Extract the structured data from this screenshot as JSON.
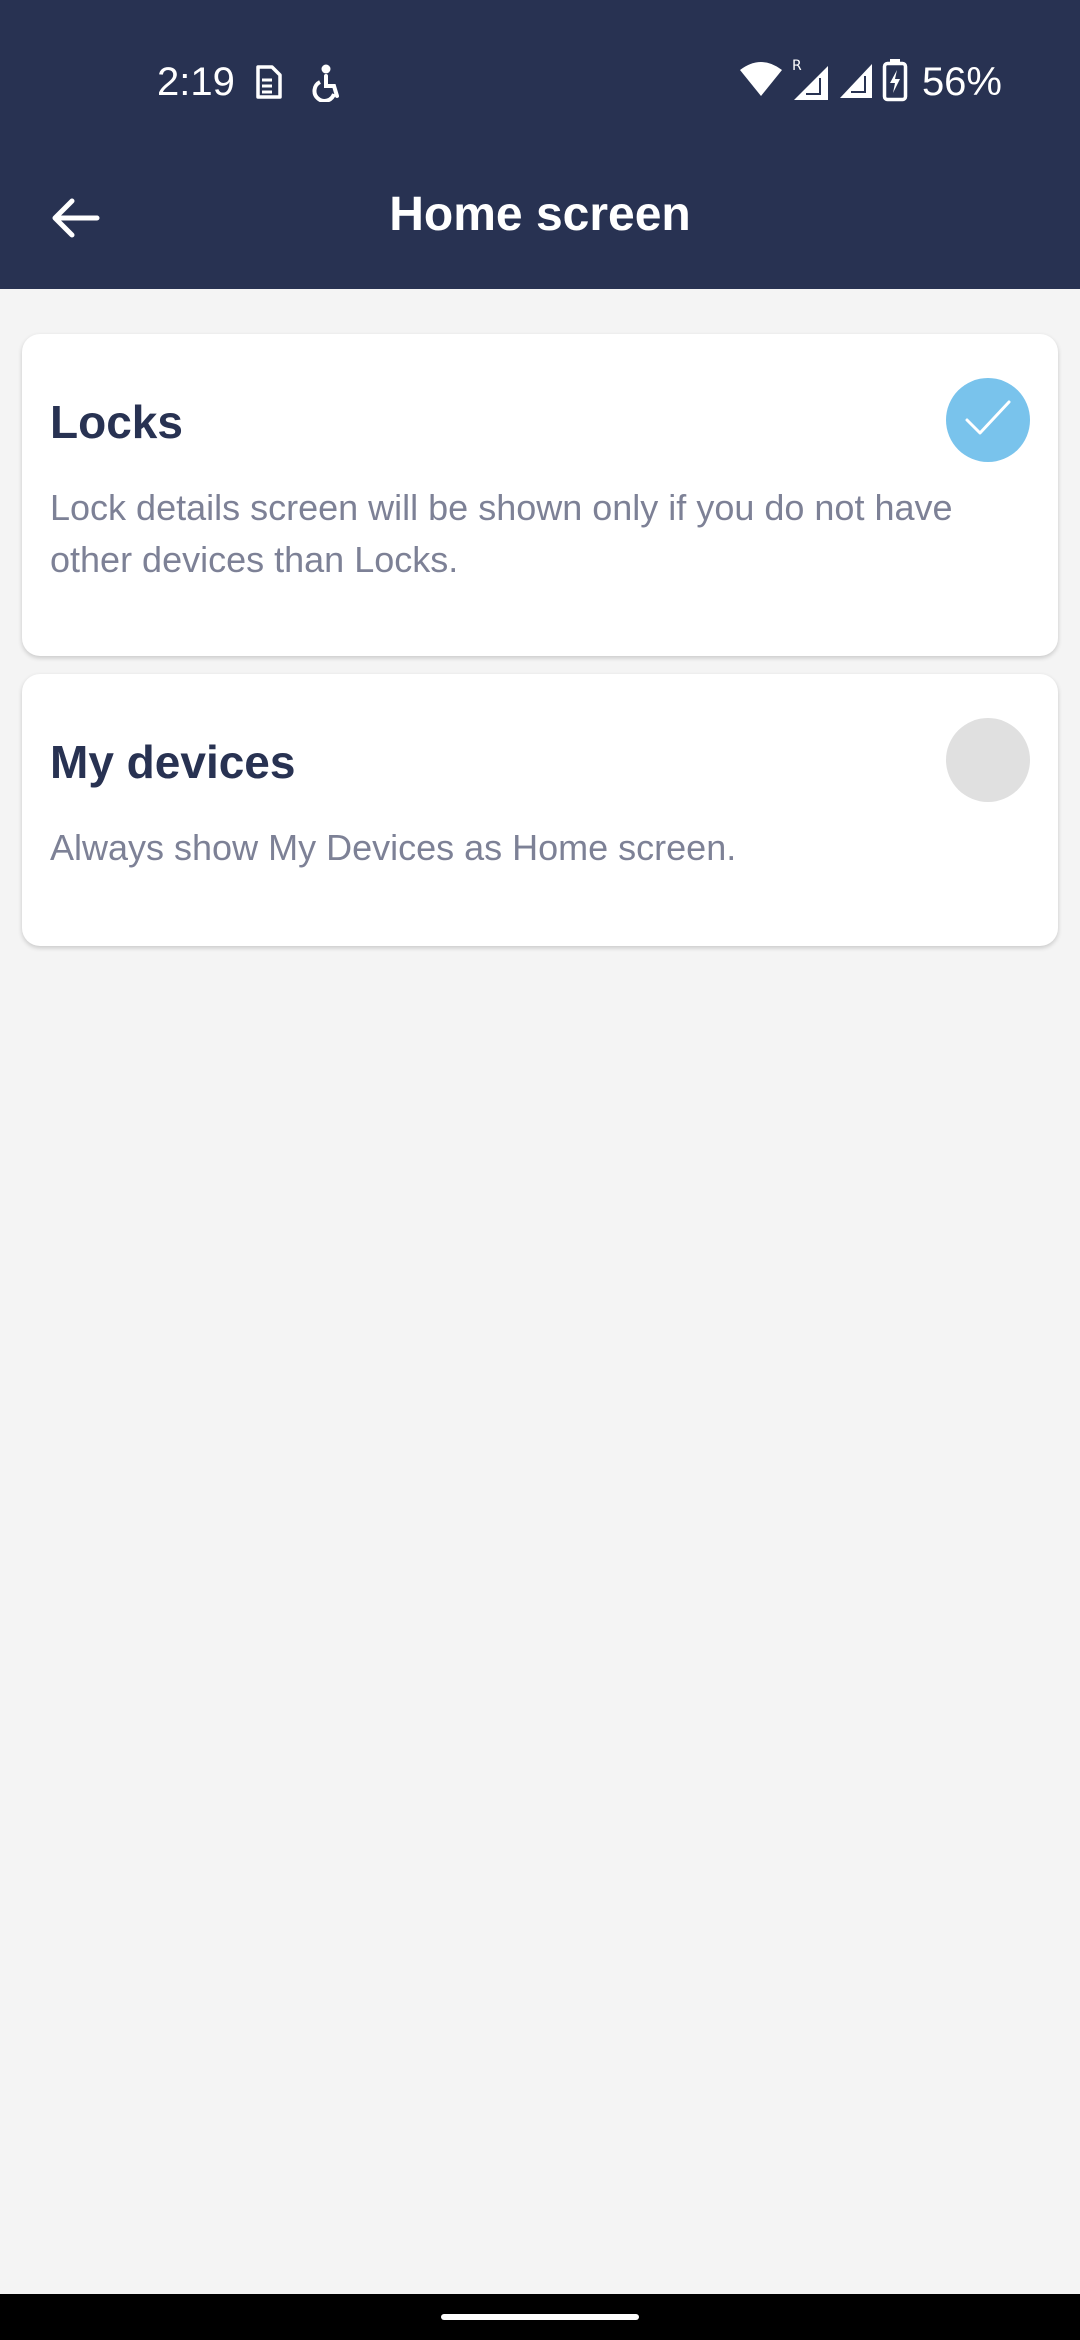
{
  "status_bar": {
    "time": "2:19",
    "battery": "56%",
    "icons": [
      "sim-card-icon",
      "accessibility-icon",
      "wifi-icon",
      "roaming-signal-icon",
      "signal-icon",
      "battery-charging-icon"
    ]
  },
  "app_bar": {
    "title": "Home screen",
    "back_icon": "arrow-left-icon"
  },
  "options": [
    {
      "title": "Locks",
      "description": "Lock details screen will be shown only if you do not have other devices than Locks.",
      "selected": true
    },
    {
      "title": "My devices",
      "description": "Always show My Devices as Home screen.",
      "selected": false
    }
  ],
  "colors": {
    "header": "#283252",
    "background": "#f4f4f4",
    "selected": "#79c3ec",
    "unselected": "#e0e0e0",
    "title_text": "#283252",
    "description_text": "#7d8196"
  }
}
